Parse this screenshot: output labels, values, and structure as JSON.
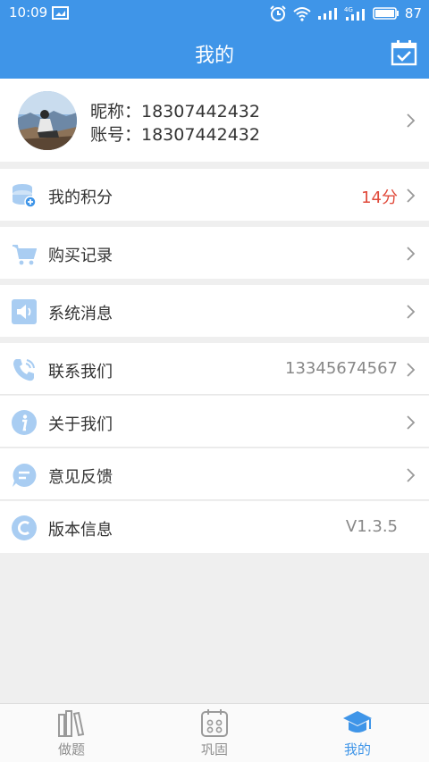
{
  "status_bar": {
    "time": "10:09",
    "battery": "87"
  },
  "header": {
    "title": "我的"
  },
  "profile": {
    "nickname_line": "昵称：18307442432",
    "account_line": "账号：18307442432"
  },
  "menu": {
    "points": {
      "label": "我的积分",
      "value": "14分"
    },
    "purchases": {
      "label": "购买记录"
    },
    "messages": {
      "label": "系统消息"
    },
    "contact": {
      "label": "联系我们",
      "value": "13345674567"
    },
    "about": {
      "label": "关于我们"
    },
    "feedback": {
      "label": "意见反馈"
    },
    "version": {
      "label": "版本信息",
      "value": "V1.3.5"
    }
  },
  "tabbar": {
    "tabs": [
      {
        "label": "做题"
      },
      {
        "label": "巩固"
      },
      {
        "label": "我的"
      }
    ],
    "active_index": 2
  },
  "colors": {
    "brand": "#3f95e8",
    "points_value": "#e04a3b",
    "icon_light": "#a9cdf2"
  }
}
